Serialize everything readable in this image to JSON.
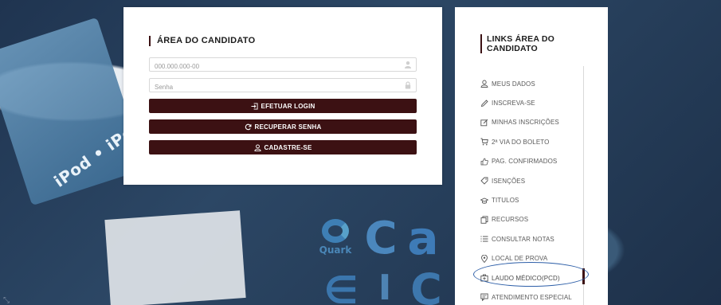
{
  "login": {
    "title": "ÁREA DO CANDIDATO",
    "cpf_placeholder": "000.000.000-00",
    "password_placeholder": "Senha",
    "login_button": "EFETUAR LOGIN",
    "recover_button": "RECUPERAR SENHA",
    "register_button": "CADASTRE-SE"
  },
  "links": {
    "title": "LINKS ÁREA DO CANDIDATO",
    "items": [
      {
        "label": "MEUS DADOS",
        "icon": "user-icon"
      },
      {
        "label": "INSCREVA-SE",
        "icon": "pencil-icon"
      },
      {
        "label": "MINHAS INSCRIÇÕES",
        "icon": "edit-square-icon"
      },
      {
        "label": "2ª VIA DO BOLETO",
        "icon": "cart-icon"
      },
      {
        "label": "PAG. CONFIRMADOS",
        "icon": "thumbs-up-icon"
      },
      {
        "label": "ISENÇÕES",
        "icon": "tag-icon"
      },
      {
        "label": "TITULOS",
        "icon": "graduation-cap-icon"
      },
      {
        "label": "RECURSOS",
        "icon": "copy-icon"
      },
      {
        "label": "CONSULTAR NOTAS",
        "icon": "list-icon"
      },
      {
        "label": "LOCAL DE PROVA",
        "icon": "map-pin-icon"
      },
      {
        "label": "LAUDO MÉDICO(PCD)",
        "icon": "medical-kit-icon",
        "active": true
      },
      {
        "label": "ATENDIMENTO ESPECIAL",
        "icon": "chat-icon"
      }
    ]
  },
  "background": {
    "ipod_text": "iPod • iPod mi",
    "quark_label": "Quark"
  },
  "colors": {
    "accent": "#3c1113",
    "highlight_ellipse": "#2e5fa8"
  }
}
